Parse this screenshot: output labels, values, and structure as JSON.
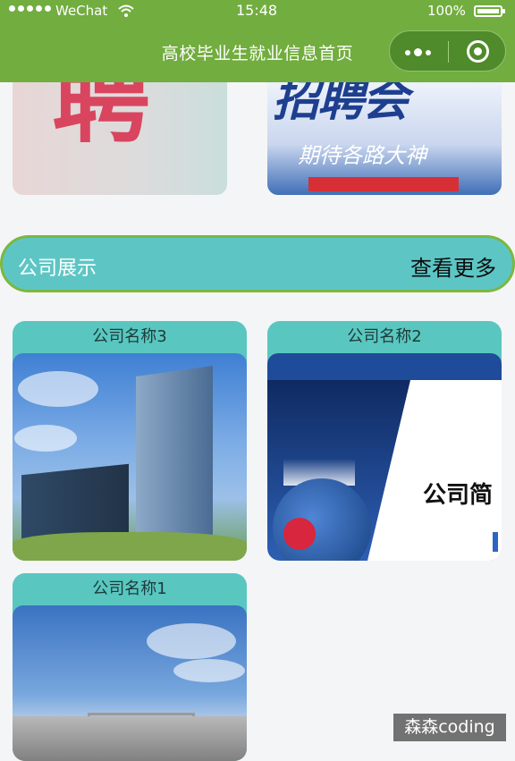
{
  "status_bar": {
    "carrier": "WeChat",
    "time": "15:48",
    "battery": "100%"
  },
  "nav": {
    "title": "高校毕业生就业信息首页"
  },
  "banners": [
    {
      "text": "聘"
    },
    {
      "text": "招聘会",
      "slogan": "期待各路大神"
    }
  ],
  "section": {
    "title": "公司展示",
    "more": "查看更多"
  },
  "companies": [
    {
      "name": "公司名称3"
    },
    {
      "name": "公司名称2",
      "image_text": "公司简"
    },
    {
      "name": "公司名称1"
    }
  ],
  "watermark": "森森coding",
  "colors": {
    "nav_green": "#72ad3f",
    "teal": "#5dc6c5",
    "card_teal": "#59c7c0",
    "border_green": "#7bb83e"
  }
}
